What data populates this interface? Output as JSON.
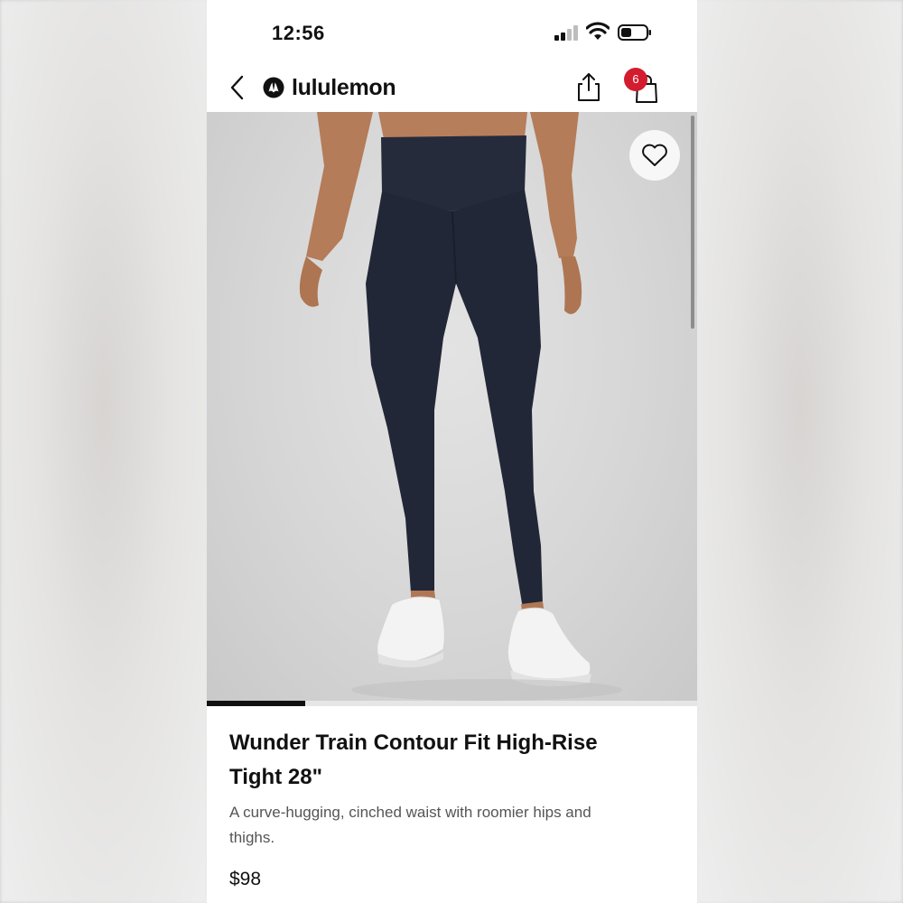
{
  "status_bar": {
    "time": "12:56"
  },
  "header": {
    "brand": "lululemon",
    "cart_count": "6",
    "icons": [
      "chevron-left-icon",
      "lululemon-logo-icon",
      "share-icon",
      "shopping-bag-icon"
    ]
  },
  "product": {
    "title": "Wunder Train Contour Fit High-Rise Tight 28\"",
    "description": "A curve-hugging, cinched waist with roomier hips and thighs.",
    "price": "$98",
    "image_carousel_progress": 0.2
  },
  "colors": {
    "badge": "#d31c2e",
    "text": "#111111",
    "leggings": "#232838"
  }
}
